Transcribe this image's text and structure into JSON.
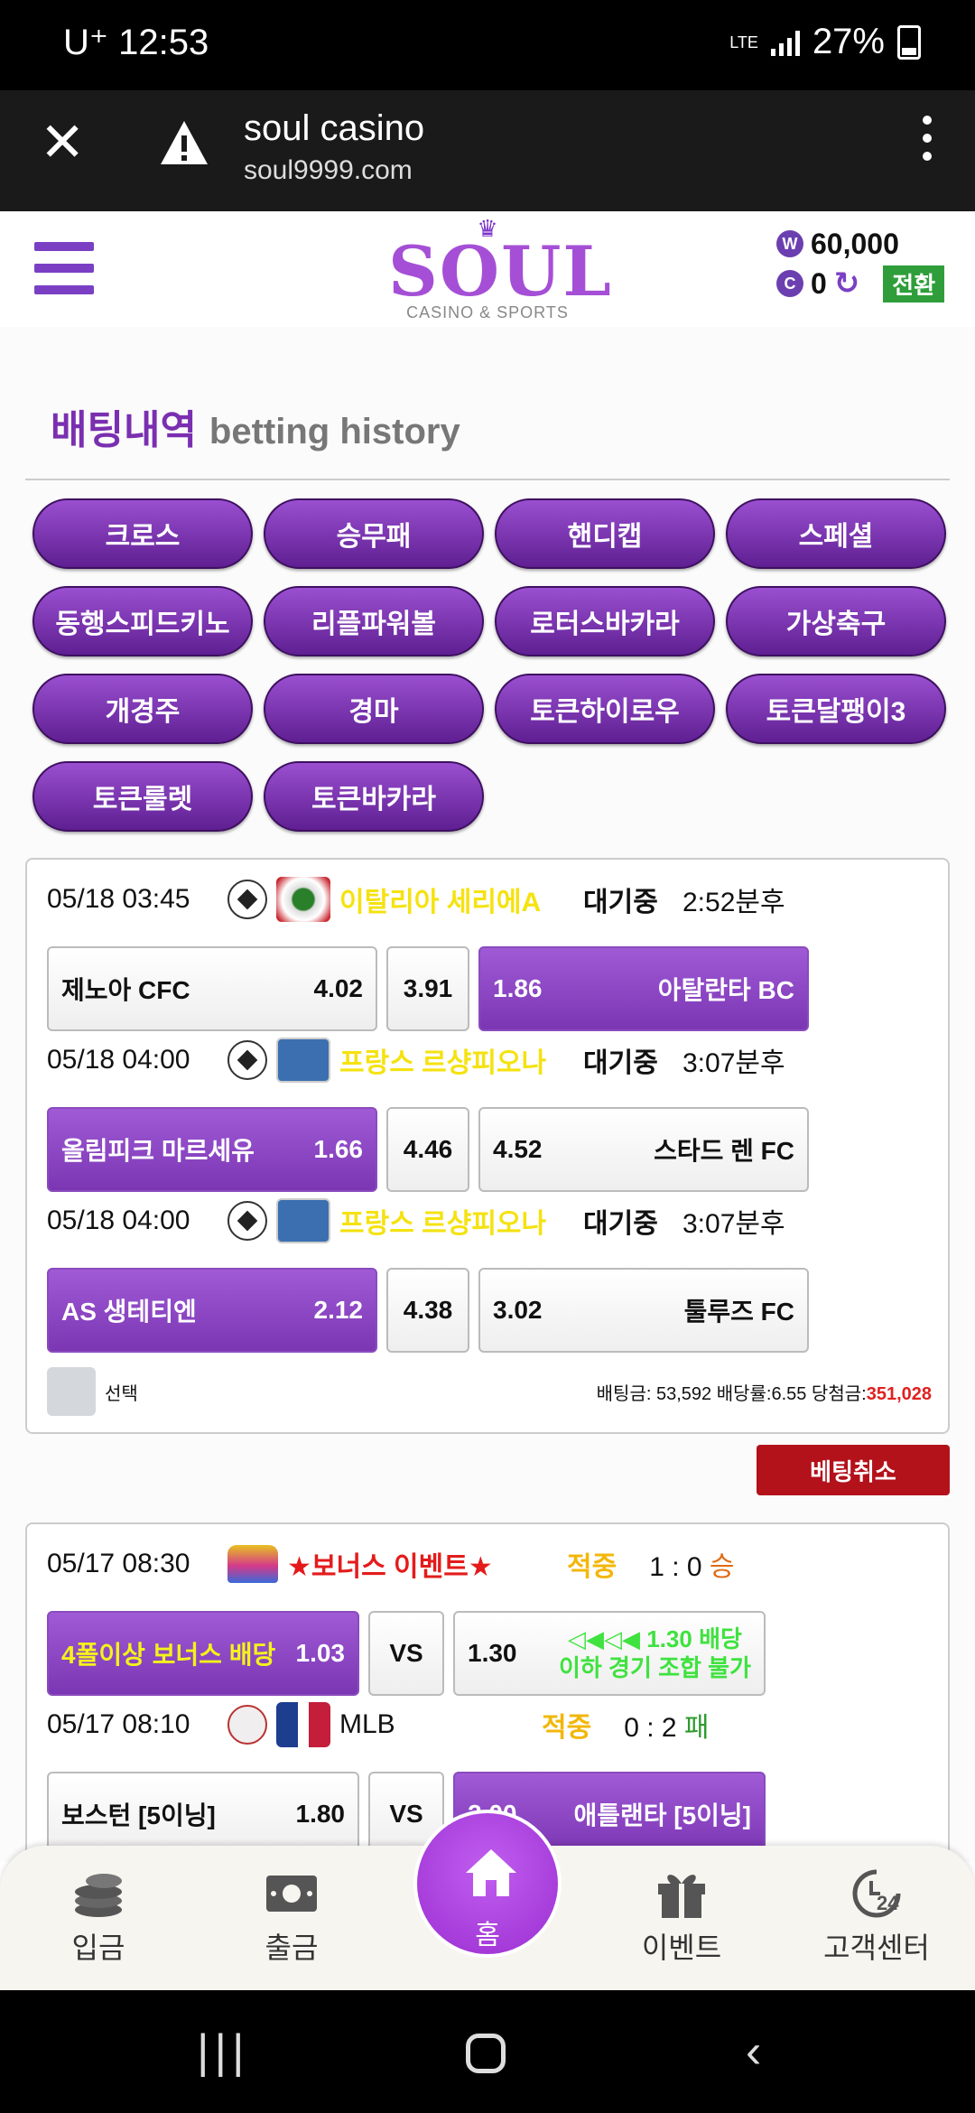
{
  "status_bar": {
    "carrier_time": "U⁺ 12:53",
    "network": "LTE",
    "battery": "27%"
  },
  "browser": {
    "title": "soul casino",
    "url": "soul9999.com"
  },
  "header": {
    "logo": "SOUL",
    "logo_sub": "CASINO & SPORTS",
    "balance_w": "60,000",
    "balance_c": "0",
    "convert_label": "전환"
  },
  "history": {
    "title_ko": "배팅내역",
    "title_en": "betting history"
  },
  "categories": [
    "크로스",
    "승무패",
    "핸디캡",
    "스페셜",
    "동행스피드키노",
    "리플파워볼",
    "로터스바카라",
    "가상축구",
    "개경주",
    "경마",
    "토큰하이로우",
    "토큰달팽이3",
    "토큰룰렛",
    "토큰바카라"
  ],
  "bet1": {
    "matches": [
      {
        "datetime": "05/18 03:45",
        "league": "이탈리아 세리에A",
        "status": "대기중",
        "remain": "2:52분후",
        "home": "제노아 CFC",
        "home_odd": "4.02",
        "draw": "3.91",
        "away_odd": "1.86",
        "away": "아탈란타 BC"
      },
      {
        "datetime": "05/18 04:00",
        "league": "프랑스 르샹피오나",
        "status": "대기중",
        "remain": "3:07분후",
        "home": "올림피크 마르세유",
        "home_odd": "1.66",
        "draw": "4.46",
        "away_odd": "4.52",
        "away": "스타드 렌 FC"
      },
      {
        "datetime": "05/18 04:00",
        "league": "프랑스 르샹피오나",
        "status": "대기중",
        "remain": "3:07분후",
        "home": "AS 생테티엔",
        "home_odd": "2.12",
        "draw": "4.38",
        "away_odd": "3.02",
        "away": "툴루즈 FC"
      }
    ],
    "select_label": "선택",
    "summary_prefix": "배팅금: 53,592 배당률:6.55 당첨금:",
    "summary_win": "351,028",
    "cancel_label": "베팅취소"
  },
  "bet2": {
    "matches": [
      {
        "datetime": "05/17 08:30",
        "league": "★보너스 이벤트★",
        "status": "적중",
        "score": "1 : 0",
        "result": "승",
        "home": "4폴이상 보너스 배당",
        "home_odd": "1.03",
        "vs": "VS",
        "away_odd": "1.30",
        "away_line1": "◁◀◁◀ 1.30 배당",
        "away_line2": "이하 경기 조합 불가"
      },
      {
        "datetime": "05/17 08:10",
        "league": "MLB",
        "status": "적중",
        "score": "0 : 2",
        "result": "패",
        "home": "보스턴 [5이닝]",
        "home_odd": "1.80",
        "vs": "VS",
        "away_odd": "2.00",
        "away": "애틀랜타 [5이닝]"
      }
    ]
  },
  "bottom_nav": {
    "deposit": "입금",
    "withdraw": "출금",
    "home": "홈",
    "event": "이벤트",
    "support": "고객센터"
  }
}
